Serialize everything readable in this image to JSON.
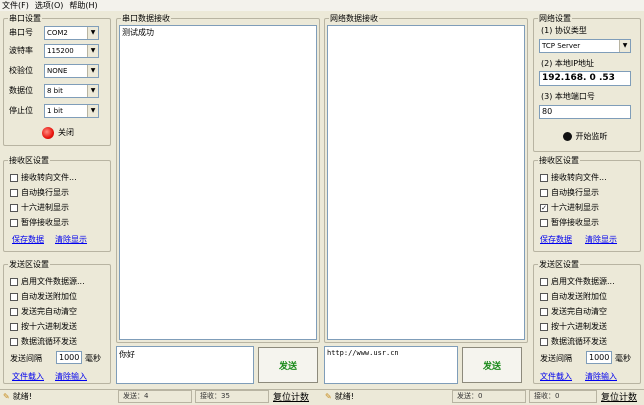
{
  "menu": [
    "文件(F)",
    "选项(O)",
    "帮助(H)"
  ],
  "serial": {
    "title": "串口设置",
    "port_label": "串口号",
    "port_value": "COM2",
    "baud_label": "波特率",
    "baud_value": "115200",
    "parity_label": "校验位",
    "parity_value": "NONE",
    "data_label": "数据位",
    "data_value": "8 bit",
    "stop_label": "停止位",
    "stop_value": "1 bit",
    "close_button": "关闭",
    "close_color": "#e8150e"
  },
  "left_recv": {
    "title": "接收区设置",
    "opts": [
      {
        "label": "接收转向文件...",
        "checked": false
      },
      {
        "label": "自动换行显示",
        "checked": false
      },
      {
        "label": "十六进制显示",
        "checked": false
      },
      {
        "label": "暂停接收显示",
        "checked": false
      }
    ],
    "save_link": "保存数据",
    "clear_link": "清除显示"
  },
  "left_send": {
    "title": "发送区设置",
    "opts": [
      {
        "label": "启用文件数据源...",
        "checked": false
      },
      {
        "label": "自动发送附加位",
        "checked": false
      },
      {
        "label": "发送完自动清空",
        "checked": false
      },
      {
        "label": "按十六进制发送",
        "checked": false
      },
      {
        "label": "数据流循环发送",
        "checked": false
      }
    ],
    "interval_label": "发送间隔",
    "interval_value": "1000",
    "interval_unit": "毫秒",
    "load_link": "文件载入",
    "clear_link": "清除输入"
  },
  "serial_recv": {
    "title": "串口数据接收",
    "text": "测试成功"
  },
  "net_recv": {
    "title": "网络数据接收",
    "text": ""
  },
  "serial_send": {
    "text": "你好",
    "button": "发送",
    "button_color": "#1a8a1a"
  },
  "net_send": {
    "text": "http://www.usr.cn",
    "button": "发送",
    "button_color": "#1a8a1a"
  },
  "network": {
    "title": "网络设置",
    "proto_label": "(1) 协议类型",
    "proto_value": "TCP Server",
    "ip_label": "(2) 本地IP地址",
    "ip_value": "192.168. 0 .53",
    "port_label": "(3) 本地端口号",
    "port_value": "80",
    "listen_button": "开始监听"
  },
  "right_recv": {
    "title": "接收区设置",
    "opts": [
      {
        "label": "接收转向文件...",
        "checked": false
      },
      {
        "label": "自动换行显示",
        "checked": false
      },
      {
        "label": "十六进制显示",
        "checked": true
      },
      {
        "label": "暂停接收显示",
        "checked": false
      }
    ],
    "save_link": "保存数据",
    "clear_link": "清除显示"
  },
  "right_send": {
    "title": "发送区设置",
    "opts": [
      {
        "label": "启用文件数据源...",
        "checked": false
      },
      {
        "label": "自动发送附加位",
        "checked": false
      },
      {
        "label": "发送完自动清空",
        "checked": false
      },
      {
        "label": "按十六进制发送",
        "checked": false
      },
      {
        "label": "数据流循环发送",
        "checked": false
      }
    ],
    "interval_label": "发送间隔",
    "interval_value": "1000",
    "interval_unit": "毫秒",
    "load_link": "文件载入",
    "clear_link": "清除输入"
  },
  "status_left": {
    "ready": "就绪!",
    "send_label": "发送：4",
    "recv_label": "接收：35",
    "reset_label": "复位计数"
  },
  "status_right": {
    "ready": "就绪!",
    "send_label": "发送：0",
    "recv_label": "接收：0",
    "reset_label": "复位计数"
  }
}
